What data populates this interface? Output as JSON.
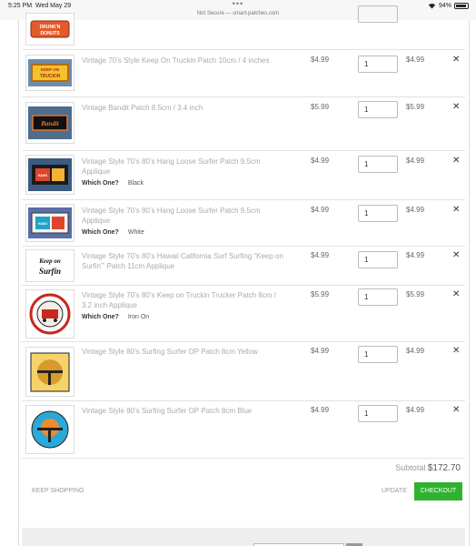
{
  "status_bar": {
    "time": "5:25 PM",
    "date": "Wed May 29",
    "address": "Not Secure — smart-patches.com",
    "battery": "94%"
  },
  "cart": {
    "items": [
      {
        "name": "",
        "option_label": "",
        "option_value": "",
        "price": "",
        "quantity": "",
        "total": "",
        "logo_text": "DRUNK'N DONUTS"
      },
      {
        "name": "Vintage 70’s Style Keep On Truckin Patch 10cm / 4 inches",
        "option_label": "",
        "option_value": "",
        "price": "$4.99",
        "quantity": "1",
        "total": "$4.99",
        "logo_text": "KEEP ON TRUCKIN"
      },
      {
        "name": "Vintage Bandit Patch 8.5cm / 3.4 inch",
        "option_label": "",
        "option_value": "",
        "price": "$5.99",
        "quantity": "1",
        "total": "$5.99",
        "logo_text": "Bandit"
      },
      {
        "name": "Vintage Style 70’s 80’s Hang Loose Surfer Patch 9.5cm Applique",
        "option_label": "Which One?",
        "option_value": "Black",
        "price": "$4.99",
        "quantity": "1",
        "total": "$4.99",
        "logo_text": "HANG LOOSE"
      },
      {
        "name": "Vintage Style 70’s 80’s Hang Loose Surfer Patch 9.5cm Applique",
        "option_label": "Which One?",
        "option_value": "White",
        "price": "$4.99",
        "quantity": "1",
        "total": "$4.99",
        "logo_text": "HANG LOOSE"
      },
      {
        "name": "Vintage Style 70’s 80’s Hawaii California Surf Surfing “Keep on Surfin’” Patch 11cm Applique",
        "option_label": "",
        "option_value": "",
        "price": "$4.99",
        "quantity": "1",
        "total": "$4.99",
        "logo_text": "Keep on Surfin"
      },
      {
        "name": "Vintage Style 70’s 80’s Keep on Truckin Trucker Patch 8cm / 3.2 inch Applique",
        "option_label": "Which One?",
        "option_value": "Iron On",
        "price": "$5.99",
        "quantity": "1",
        "total": "$5.99",
        "logo_text": "EAST BOUND & DOWN / LOADED UP & TRUCKIN"
      },
      {
        "name": "Vintage Style 80’s Surfing Surfer OP Patch 8cm Yellow",
        "option_label": "",
        "option_value": "",
        "price": "$4.99",
        "quantity": "1",
        "total": "$4.99",
        "logo_text": "OP"
      },
      {
        "name": "Vintage Style 80’s Surfing Surfer OP Patch 8cm Blue",
        "option_label": "",
        "option_value": "",
        "price": "$4.99",
        "quantity": "1",
        "total": "$4.99",
        "logo_text": "OP"
      }
    ],
    "remove_glyph": "✕",
    "subtotal_label": "Subtotal",
    "subtotal_value": "$172.70",
    "keep_shopping": "KEEP SHOPPING",
    "update": "UPDATE",
    "checkout": "CHECKOUT"
  },
  "colors": {
    "accent": "#2fb22f"
  }
}
